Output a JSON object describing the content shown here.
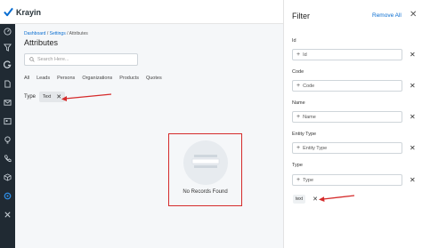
{
  "app": {
    "name": "Krayin"
  },
  "breadcrumb": [
    "Dashboard",
    "Settings",
    "Attributes"
  ],
  "breadcrumb_sep": "/",
  "page": {
    "title": "Attributes"
  },
  "search": {
    "placeholder": "Search Here..."
  },
  "tabs": [
    "All",
    "Leads",
    "Persons",
    "Organizations",
    "Products",
    "Quotes"
  ],
  "type_filter": {
    "label": "Type",
    "chip_value": "Text"
  },
  "empty": {
    "message": "No Records Found"
  },
  "filter_panel": {
    "title": "Filter",
    "remove_all": "Remove All",
    "fields": [
      {
        "label": "Id",
        "placeholder": "Id"
      },
      {
        "label": "Code",
        "placeholder": "Code"
      },
      {
        "label": "Name",
        "placeholder": "Name"
      },
      {
        "label": "Entity Type",
        "placeholder": "Entity Type"
      },
      {
        "label": "Type",
        "placeholder": "Type"
      }
    ],
    "applied_value": "text"
  },
  "sidebar_icons": [
    "dashboard-icon",
    "filter-icon",
    "g-icon",
    "document-icon",
    "mail-icon",
    "contact-card-icon",
    "lightbulb-icon",
    "phone-icon",
    "box-icon",
    "settings-icon",
    "tools-icon"
  ],
  "colors": {
    "accent": "#0a6ed1",
    "sidebar": "#202a33",
    "highlight": "#d52b2b"
  }
}
